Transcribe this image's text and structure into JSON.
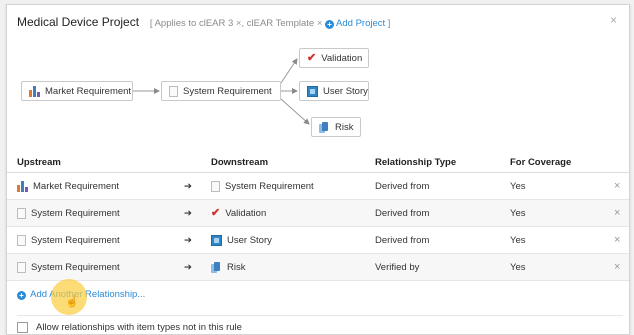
{
  "header": {
    "title": "Medical Device Project",
    "applies_prefix": "[ Applies to ",
    "project1": "clEAR 3",
    "project2": "clEAR Template",
    "add_project": "Add Project",
    "applies_suffix": " ]",
    "tag_remove": "×",
    "close": "×"
  },
  "diagram": {
    "source": "Market Requirement",
    "middle": "System Requirement",
    "targets": [
      "Validation",
      "User Story",
      "Risk"
    ]
  },
  "table": {
    "columns": {
      "upstream": "Upstream",
      "downstream": "Downstream",
      "relationship_type": "Relationship Type",
      "for_coverage": "For Coverage"
    },
    "arrow": "➔",
    "remove": "×",
    "rows": [
      {
        "upstream": "Market Requirement",
        "downstream": "System Requirement",
        "type": "Derived from",
        "coverage": "Yes"
      },
      {
        "upstream": "System Requirement",
        "downstream": "Validation",
        "type": "Derived from",
        "coverage": "Yes"
      },
      {
        "upstream": "System Requirement",
        "downstream": "User Story",
        "type": "Derived from",
        "coverage": "Yes"
      },
      {
        "upstream": "System Requirement",
        "downstream": "Risk",
        "type": "Verified by",
        "coverage": "Yes"
      }
    ]
  },
  "add_relationship": "Add Another Relationship...",
  "allow_checkbox": {
    "label": "Allow relationships with item types not in this rule",
    "checked": false
  },
  "icons": {
    "market": "bar-chart-icon",
    "system": "document-icon",
    "validation": "checkmark-icon",
    "story": "story-card-icon",
    "risk": "stacked-cards-icon"
  },
  "colors": {
    "accent": "#2b8bd6",
    "check": "#d0312d",
    "story": "#2e86c9"
  }
}
